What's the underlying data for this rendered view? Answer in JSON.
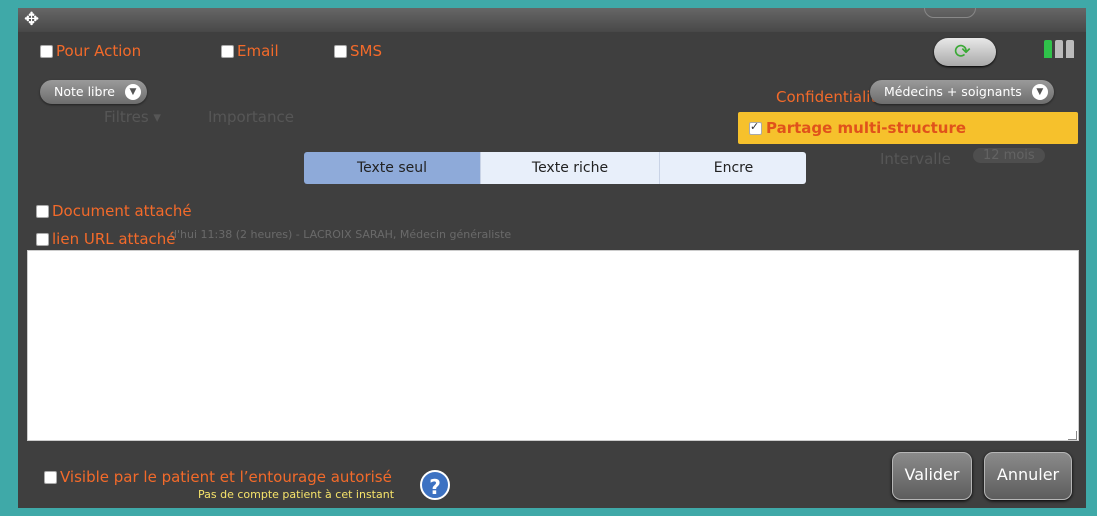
{
  "options": {
    "pour_action": "Pour Action",
    "email": "Email",
    "sms": "SMS",
    "document_attache": "Document attaché",
    "lien_url": "lien URL attaché",
    "visible_patient": "Visible par le patient et l’entourage autorisé"
  },
  "note_type": {
    "value": "Note libre"
  },
  "confidentialite": {
    "label": "Confidentialité",
    "value": "Médecins + soignants"
  },
  "partage": {
    "label": "Partage multi-structure",
    "checked": true
  },
  "editor_tabs": [
    "Texte seul",
    "Texte riche",
    "Encre"
  ],
  "active_tab": "Texte seul",
  "editor": {
    "value": ""
  },
  "buttons": {
    "valider": "Valider",
    "annuler": "Annuler"
  },
  "patient_notice": "Pas de compte patient à cet instant",
  "background": {
    "filtres": "Filtres",
    "importance": "Importance",
    "intervalle": "Intervalle",
    "intervalle_value": "12 mois",
    "author": "d'hui 11:38 (2 heures) - LACROIX SARAH, Médecin généraliste"
  },
  "colors": {
    "accent_orange": "#f36a2a",
    "partage_bg": "#f6c12c",
    "tab_active": "#8eaad9",
    "tab_inactive": "#e8effa",
    "frame": "#3fa9a8"
  },
  "icons": [
    "move-icon",
    "refresh-icon",
    "help-icon",
    "chevron-down-icon"
  ]
}
